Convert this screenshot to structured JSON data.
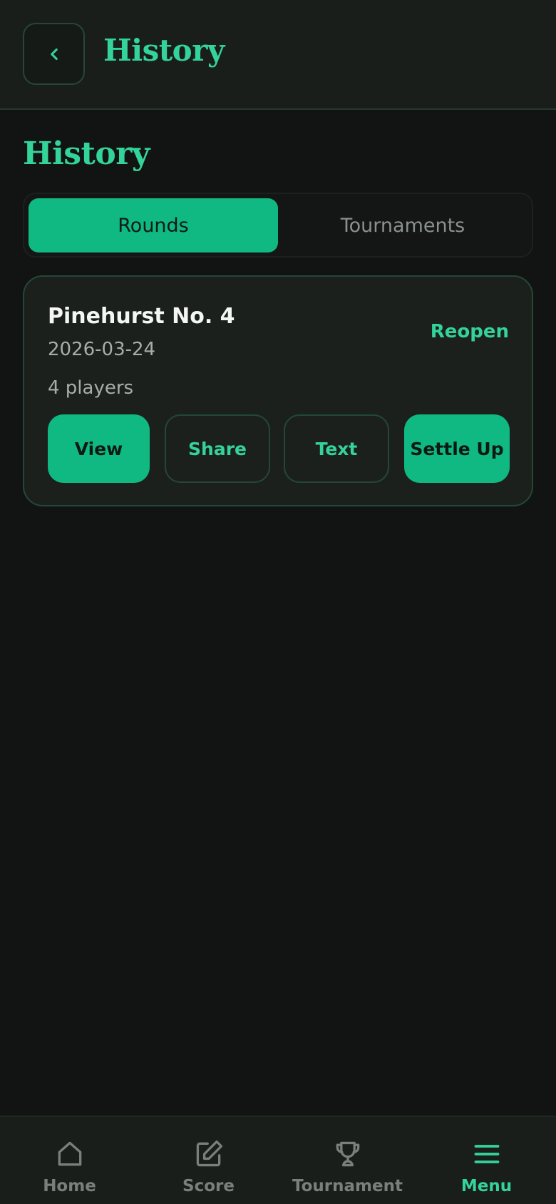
{
  "header": {
    "back_icon": "chevron-left-icon",
    "title": "History"
  },
  "page": {
    "title": "History"
  },
  "tabs": [
    {
      "label": "Rounds",
      "active": true
    },
    {
      "label": "Tournaments",
      "active": false
    }
  ],
  "round_card": {
    "course": "Pinehurst No. 4",
    "date": "2026-03-24",
    "players": "4 players",
    "reopen_label": "Reopen",
    "actions": {
      "view": "View",
      "share": "Share",
      "text": "Text",
      "settle": "Settle Up"
    }
  },
  "bottom_nav": [
    {
      "label": "Home",
      "icon": "home-icon",
      "active": false
    },
    {
      "label": "Score",
      "icon": "edit-icon",
      "active": false
    },
    {
      "label": "Tournament",
      "icon": "trophy-icon",
      "active": false
    },
    {
      "label": "Menu",
      "icon": "menu-icon",
      "active": true
    }
  ],
  "colors": {
    "accent": "#10b981",
    "accent_text": "#34d399",
    "background": "#111412",
    "card": "#1c201d"
  }
}
